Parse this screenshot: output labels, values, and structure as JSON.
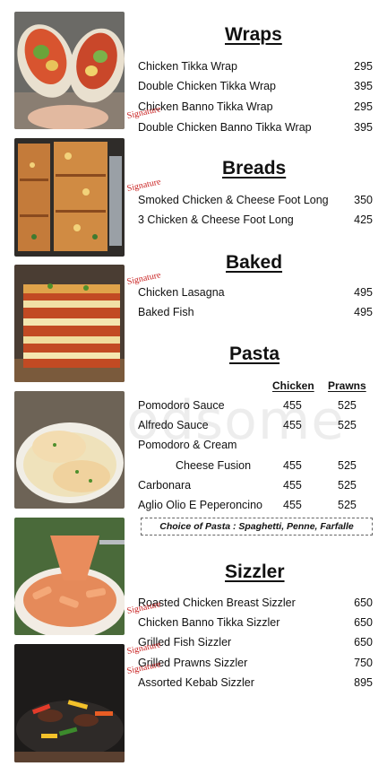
{
  "watermark": "Foodsome",
  "signature_label": "Signature",
  "sections": {
    "wraps": {
      "title": "Wraps",
      "items": [
        {
          "name": "Chicken Tikka Wrap",
          "price": "295"
        },
        {
          "name": "Double Chicken Tikka Wrap",
          "price": "395"
        },
        {
          "name": "Chicken Banno Tikka Wrap",
          "price": "295"
        },
        {
          "name": "Double Chicken Banno Tikka Wrap",
          "price": "395",
          "signature": true
        }
      ]
    },
    "breads": {
      "title": "Breads",
      "items": [
        {
          "name": "Smoked Chicken & Cheese Foot Long",
          "price": "350",
          "signature": true
        },
        {
          "name": "3 Chicken & Cheese Foot Long",
          "price": "425"
        }
      ]
    },
    "baked": {
      "title": "Baked",
      "items": [
        {
          "name": "Chicken Lasagna",
          "price": "495",
          "signature": true
        },
        {
          "name": "Baked Fish",
          "price": "495"
        }
      ]
    },
    "pasta": {
      "title": "Pasta",
      "columns": [
        "Chicken",
        "Prawns"
      ],
      "items": [
        {
          "name": "Pomodoro Sauce",
          "chicken": "455",
          "prawns": "525"
        },
        {
          "name": "Alfredo Sauce",
          "chicken": "455",
          "prawns": "525"
        },
        {
          "name": "Pomodoro & Cream",
          "chicken": "",
          "prawns": ""
        },
        {
          "name": "Cheese Fusion",
          "chicken": "455",
          "prawns": "525"
        },
        {
          "name": "Carbonara",
          "chicken": "455",
          "prawns": "525"
        },
        {
          "name": "Aglio Olio E Peperoncino",
          "chicken": "455",
          "prawns": "525"
        }
      ],
      "note": "Choice of Pasta : Spaghetti, Penne, Farfalle"
    },
    "sizzler": {
      "title": "Sizzler",
      "items": [
        {
          "name": "Roasted Chicken Breast Sizzler",
          "price": "650"
        },
        {
          "name": "Chicken Banno Tikka Sizzler",
          "price": "650",
          "signature": true
        },
        {
          "name": "Grilled Fish Sizzler",
          "price": "650"
        },
        {
          "name": "Grilled Prawns Sizzler",
          "price": "750",
          "signature": true
        },
        {
          "name": "Assorted Kebab Sizzler",
          "price": "895",
          "signature": true
        }
      ]
    }
  }
}
